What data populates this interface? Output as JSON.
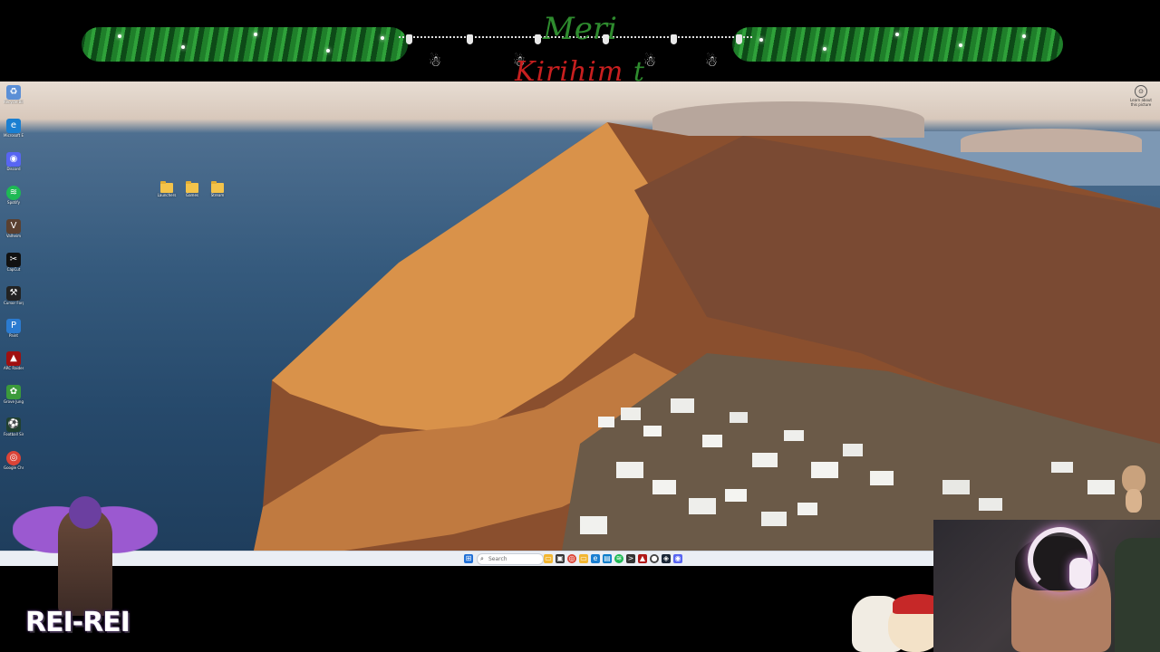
{
  "banner": {
    "title_line1": "Meri",
    "title_line2_red": "Kirihim",
    "title_line2_green": "t"
  },
  "desktop": {
    "icons": [
      {
        "label": "Recycle Bin",
        "icon": "recycle-bin-icon",
        "color": "#5b8fd6",
        "glyph": "♻"
      },
      {
        "label": "Microsoft Edge",
        "icon": "edge-icon",
        "color": "#1a7fd1",
        "glyph": "e"
      },
      {
        "label": "Discord",
        "icon": "discord-icon",
        "color": "#5865f2",
        "glyph": "◉"
      },
      {
        "label": "Spotify",
        "icon": "spotify-icon",
        "color": "#1db954",
        "glyph": "≋"
      },
      {
        "label": "Valheim",
        "icon": "valheim-icon",
        "color": "#5a4030",
        "glyph": "V"
      },
      {
        "label": "CapCut",
        "icon": "capcut-icon",
        "color": "#111111",
        "glyph": "✂"
      },
      {
        "label": "Cursor Forge",
        "icon": "forge-icon",
        "color": "#222222",
        "glyph": "⚒"
      },
      {
        "label": "Paint",
        "icon": "paint-icon",
        "color": "#2b7bd0",
        "glyph": "P"
      },
      {
        "label": "ARC Raiders",
        "icon": "arc-raiders-icon",
        "color": "#a01010",
        "glyph": "▲"
      },
      {
        "label": "Grove Jungle",
        "icon": "grove-icon",
        "color": "#3b9a3b",
        "glyph": "✿"
      },
      {
        "label": "Football Simulator 2",
        "icon": "football-icon",
        "color": "#204030",
        "glyph": "⚽"
      },
      {
        "label": "Google Chrome",
        "icon": "chrome-icon",
        "color": "#db4437",
        "glyph": "◎"
      }
    ],
    "folders": [
      {
        "label": "Launchers"
      },
      {
        "label": "Games"
      },
      {
        "label": "Stream"
      }
    ],
    "widget": {
      "label": "Learn about this picture",
      "glyph": "⊙"
    }
  },
  "taskbar": {
    "search_placeholder": "Search",
    "apps": [
      {
        "name": "start-button",
        "color": "#1f6fd6",
        "glyph": "⊞"
      },
      {
        "name": "file-explorer-icon",
        "color": "#f2b632",
        "glyph": "▭"
      },
      {
        "name": "taskview-icon",
        "color": "#333333",
        "glyph": "▣"
      },
      {
        "name": "chrome-taskbar-icon",
        "color": "#db4437",
        "glyph": "◎"
      },
      {
        "name": "folder-taskbar-icon",
        "color": "#f2b632",
        "glyph": "▭"
      },
      {
        "name": "edge-taskbar-icon",
        "color": "#1a7fd1",
        "glyph": "e"
      },
      {
        "name": "store-taskbar-icon",
        "color": "#0d7cc9",
        "glyph": "▤"
      },
      {
        "name": "spotify-taskbar-icon",
        "color": "#1db954",
        "glyph": "≋"
      },
      {
        "name": "terminal-taskbar-icon",
        "color": "#333333",
        "glyph": ">"
      },
      {
        "name": "arc-taskbar-icon",
        "color": "#b01818",
        "glyph": "▲"
      },
      {
        "name": "obs-taskbar-icon",
        "color": "#444444",
        "glyph": "●"
      },
      {
        "name": "steam-taskbar-icon",
        "color": "#1b2838",
        "glyph": "◈"
      },
      {
        "name": "discord-taskbar-icon",
        "color": "#5865f2",
        "glyph": "◉"
      }
    ]
  },
  "overlay": {
    "logo_text": "REI-REI"
  }
}
